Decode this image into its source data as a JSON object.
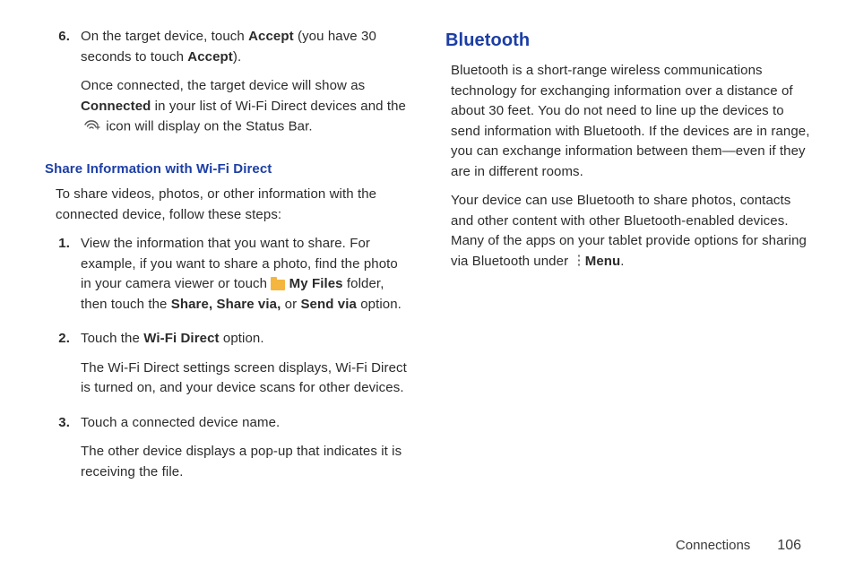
{
  "left": {
    "item6": {
      "num": "6.",
      "p1_a": "On the target device, touch ",
      "p1_bold1": "Accept",
      "p1_b": " (you have 30 seconds to touch ",
      "p1_bold2": "Accept",
      "p1_c": ").",
      "p2_a": "Once connected, the target device will show as ",
      "p2_bold": "Connected",
      "p2_b": " in your list of Wi-Fi Direct devices and the ",
      "p2_c": " icon will display on the Status Bar."
    },
    "heading_share": "Share Information with Wi-Fi Direct",
    "intro": "To share videos, photos, or other information with the connected device, follow these steps:",
    "item1": {
      "num": "1.",
      "p1_a": "View the information that you want to share. For example, if you want to share a photo, find the photo in your camera viewer or touch ",
      "p1_bold1": "My Files",
      "p1_b": " folder, then touch the ",
      "p1_bold2": "Share, Share via,",
      "p1_c": " or ",
      "p1_bold3": "Send via",
      "p1_d": " option."
    },
    "item2": {
      "num": "2.",
      "p1_a": "Touch the ",
      "p1_bold": "Wi-Fi Direct",
      "p1_b": " option.",
      "p2": "The Wi-Fi Direct settings screen displays, Wi-Fi Direct is turned on, and your device scans for other devices."
    },
    "item3": {
      "num": "3.",
      "p1": "Touch a connected device name.",
      "p2": "The other device displays a pop-up that indicates it is receiving the file."
    }
  },
  "right": {
    "heading": "Bluetooth",
    "p1": "Bluetooth is a short-range wireless communications technology for exchanging information over a distance of about 30 feet. You do not need to line up the devices to send information with Bluetooth. If the devices are in range, you can exchange information between them—even if they are in different rooms.",
    "p2_a": "Your device can use Bluetooth to share photos, contacts and other content with other Bluetooth-enabled devices. Many of the apps on your tablet provide options for sharing via Bluetooth under ",
    "p2_bold": "Menu",
    "p2_b": "."
  },
  "footer": {
    "section": "Connections",
    "page": "106"
  }
}
